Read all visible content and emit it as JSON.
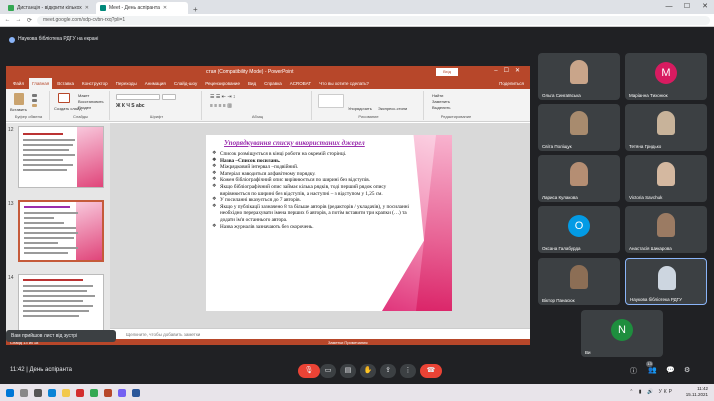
{
  "browser": {
    "tabs": [
      {
        "label": "Дистанція - відкрити кількох",
        "active": false
      },
      {
        "label": "Meet - День аспіранта",
        "active": true
      }
    ],
    "new_tab": "+",
    "url": "meet.google.com/xdp-cvbn-rxq?pli=1",
    "nav_back": "←",
    "nav_forward": "→",
    "nav_reload": "⟳"
  },
  "meet": {
    "presenting_text": "Наукова бібліотека РДГУ на екрані",
    "presenter_label": "Вам прийшов лист від зустрі",
    "time_text": "11:42",
    "meeting_name": "День аспіранта",
    "people_count": "13"
  },
  "ppt": {
    "title": "стая (Compatibility Mode) - PowerPoint",
    "login_label": "Вхід",
    "menu": [
      "Файл",
      "Главная",
      "Вставка",
      "Конструктор",
      "Переходы",
      "Анимация",
      "Слайд-шоу",
      "Рецензирование",
      "Вид",
      "Справка",
      "ACROBAT",
      "Что вы хотите сделать?"
    ],
    "active_menu": "Главная",
    "share_label": "Поделиться",
    "ribbon": {
      "paste": "Вставить",
      "create_slide": "Создать слайд",
      "clipboard": "Буфер обмена",
      "slides": "Слайды",
      "font": "Шрифт",
      "paragraph": "Абзац",
      "drawing": "Рисование",
      "arrange": "Упорядочить",
      "styles": "Экспресс-стили",
      "find": "Найти",
      "replace": "Заменить",
      "select": "Выделить",
      "editing": "Редактирование",
      "layout": "Макет",
      "reset": "Восстановить",
      "section": "Раздел"
    },
    "thumb_numbers": [
      "12",
      "13",
      "14"
    ],
    "notes_placeholder": "Щелкните, чтобы добавить заметки",
    "status_left": "Слайд 13 из 18",
    "status_right": "Заметки   Примечания"
  },
  "slide": {
    "title": "Упорядкування списку використаних джерел",
    "bullets": [
      "Список розміщується в кінці роботи на окремій сторінці.",
      "Назва –Список посилань.",
      "Міжрядковий інтервал –подвійний.",
      "Матеріал наводиться  алфавітному порядку.",
      "Кожен бібліографічний опис вирівнюється по ширині без відступів.",
      "Якщо бібліографічний опис займає кілька рядків, тоді перший рядок опису вирівнюється по ширині без відступів, а наступні – з відступом у 1,25 см.",
      "У посиланні вказується до 7 авторів.",
      "Якщо у публікації зазначено 8 та більше авторів (редакторів / укладачів), у посиланні необхідно перерахувати імена перших 6 авторів, а потім вставити три крапки (…) та додати ім'я останнього автора.",
      "Назва журналів зазначають без скорочень."
    ]
  },
  "participants": [
    {
      "name": "Ольга Сингаївська",
      "type": "photo",
      "color": "#c9a58a"
    },
    {
      "name": "Маріанна Тихонюк",
      "type": "avatar",
      "letter": "M",
      "color": "#d81b60"
    },
    {
      "name": "Світа Поліщук",
      "type": "photo",
      "color": "#a88b6e"
    },
    {
      "name": "Тетяна Гридько",
      "type": "photo",
      "color": "#c8b39a"
    },
    {
      "name": "Лариса Кулакова",
      "type": "photo",
      "color": "#b58e73"
    },
    {
      "name": "Victoria Savchuk",
      "type": "photo",
      "color": "#d4b8a0"
    },
    {
      "name": "Оксана Галабурда",
      "type": "avatar",
      "letter": "O",
      "color": "#039be5"
    },
    {
      "name": "Анастасія Шикарова",
      "type": "photo",
      "color": "#9b7b63"
    },
    {
      "name": "Віктор Панасюк",
      "type": "photo",
      "color": "#8c6e55"
    },
    {
      "name": "Наукова бібліотека РДГУ",
      "type": "photo",
      "color": "#cdd6e0"
    },
    {
      "name": "Ви",
      "type": "avatar",
      "letter": "N",
      "color": "#1e8e3e"
    }
  ],
  "taskbar": {
    "clock_time": "11:42",
    "clock_date": "15.11.2021",
    "tray_lang": "УКР"
  },
  "colors": {
    "ppt_accent": "#b7472a",
    "slide_title": "#9b2fae",
    "end_call": "#ea4335"
  }
}
